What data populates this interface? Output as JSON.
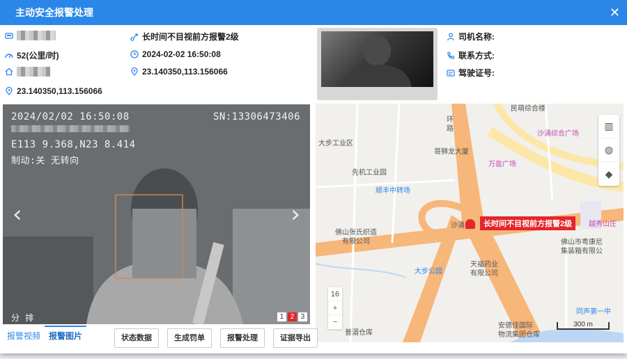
{
  "dialog": {
    "title": "主动安全报警处理",
    "close_glyph": "✕"
  },
  "info": {
    "speed": "52(公里/时)",
    "alarm_type": "长时间不目视前方报警2级",
    "time": "2024-02-02 16:50:08",
    "location_right": "23.140350,113.156066",
    "location_left": "23.140350,113.156066",
    "driver_name_label": "司机名称:",
    "contact_label": "联系方式:",
    "license_label": "驾驶证号:"
  },
  "video": {
    "timestamp": "2024/02/02 16:50:08",
    "serial": "SN:13306473406",
    "coords": "E113 9.368,N23 8.414",
    "status": "制动:关 无转向",
    "bottom_left": "分 排",
    "prev_glyph": "‹",
    "next_glyph": "›",
    "pages": [
      "1",
      "2",
      "3"
    ],
    "active_page": "2"
  },
  "map": {
    "alarm_label": "长时间不目视前方报警2级",
    "labels": {
      "dabu_industrial": "大步工业区",
      "geshilong": "哥狮龙大厦",
      "xianji": "先机工业园",
      "shunfeng": "顺丰中转场",
      "shachong_plaza": "沙涌综合广场",
      "wanying": "万盈广场",
      "zhangshi": "佛山张氏织造",
      "zhangshi2": "有限公司",
      "yuexiu": "越秀山庄",
      "yuekang": "佛山市粤康尼",
      "yuekang2": "集装箱有限公",
      "tianfu": "天福药业",
      "tianfu2": "有限公司",
      "dabu_park": "大步公园",
      "shachong": "沙涌",
      "huanlu": "环",
      "huanlu2": "路",
      "minmeng": "民萌综合楼",
      "tongsheng": "同声第一中",
      "anjie": "安德佳国际",
      "anjie2": "物流集团仓库",
      "puxiang": "普湄仓库"
    },
    "zoom_level": "16",
    "zoom_in": "+",
    "zoom_out": "−",
    "scale": "300 m"
  },
  "tabs": [
    "报警视频",
    "报警图片"
  ],
  "active_tab": "报警图片",
  "buttons": [
    "状态数据",
    "生成罚单",
    "报警处理",
    "证据导出"
  ],
  "colors": {
    "accent": "#2a87e8",
    "alarm": "#e4262b"
  }
}
